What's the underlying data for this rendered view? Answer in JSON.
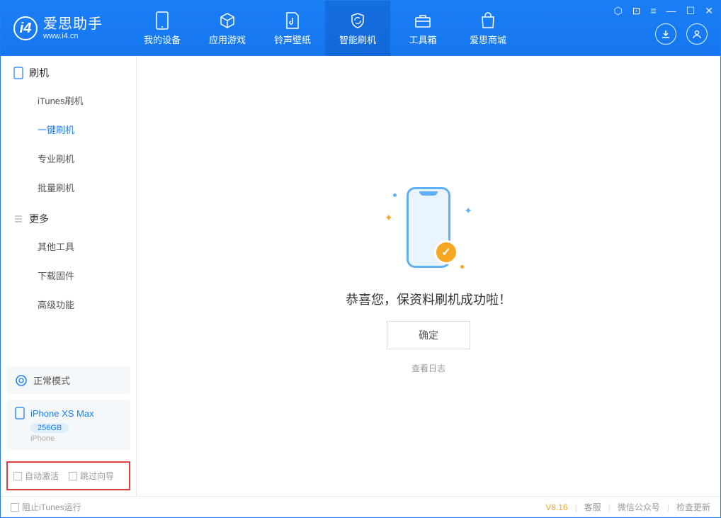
{
  "app": {
    "title": "爱思助手",
    "subtitle": "www.i4.cn"
  },
  "nav": {
    "items": [
      {
        "label": "我的设备"
      },
      {
        "label": "应用游戏"
      },
      {
        "label": "铃声壁纸"
      },
      {
        "label": "智能刷机"
      },
      {
        "label": "工具箱"
      },
      {
        "label": "爱思商城"
      }
    ]
  },
  "sidebar": {
    "group1_title": "刷机",
    "group1_items": [
      "iTunes刷机",
      "一键刷机",
      "专业刷机",
      "批量刷机"
    ],
    "group2_title": "更多",
    "group2_items": [
      "其他工具",
      "下载固件",
      "高级功能"
    ],
    "status_mode": "正常模式",
    "device": {
      "name": "iPhone XS Max",
      "storage": "256GB",
      "type": "iPhone"
    },
    "checkboxes": {
      "auto_activate": "自动激活",
      "skip_guide": "跳过向导"
    }
  },
  "main": {
    "success": "恭喜您，保资料刷机成功啦！",
    "ok_button": "确定",
    "view_log": "查看日志"
  },
  "footer": {
    "block_itunes": "阻止iTunes运行",
    "version": "V8.16",
    "links": [
      "客服",
      "微信公众号",
      "检查更新"
    ]
  }
}
